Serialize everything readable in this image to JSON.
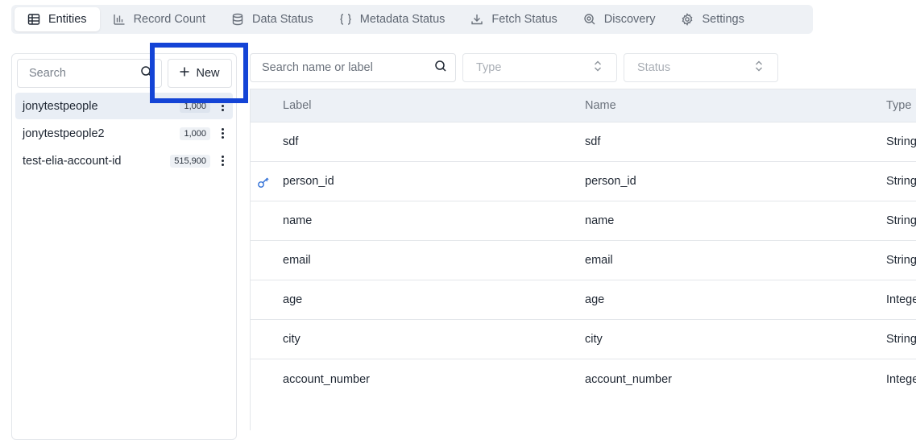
{
  "tabs": [
    {
      "label": "Entities",
      "icon": "table-icon",
      "active": true
    },
    {
      "label": "Record Count",
      "icon": "bar-chart-icon",
      "active": false
    },
    {
      "label": "Data Status",
      "icon": "database-icon",
      "active": false
    },
    {
      "label": "Metadata Status",
      "icon": "braces-icon",
      "active": false
    },
    {
      "label": "Fetch Status",
      "icon": "download-icon",
      "active": false
    },
    {
      "label": "Discovery",
      "icon": "zoom-search-icon",
      "active": false
    },
    {
      "label": "Settings",
      "icon": "gear-icon",
      "active": false
    }
  ],
  "sidebar": {
    "search_placeholder": "Search",
    "new_button_label": "New",
    "entities": [
      {
        "name": "jonytestpeople",
        "count": "1,000",
        "selected": true
      },
      {
        "name": "jonytestpeople2",
        "count": "1,000",
        "selected": false
      },
      {
        "name": "test-elia-account-id",
        "count": "515,900",
        "selected": false
      }
    ]
  },
  "main": {
    "search_placeholder": "Search name or label",
    "type_filter_placeholder": "Type",
    "status_filter_placeholder": "Status",
    "columns": {
      "label": "Label",
      "name": "Name",
      "type": "Type"
    },
    "rows": [
      {
        "label": "sdf",
        "name": "sdf",
        "type": "String",
        "key": false
      },
      {
        "label": "person_id",
        "name": "person_id",
        "type": "String",
        "key": true
      },
      {
        "label": "name",
        "name": "name",
        "type": "String",
        "key": false
      },
      {
        "label": "email",
        "name": "email",
        "type": "String",
        "key": false
      },
      {
        "label": "age",
        "name": "age",
        "type": "Integer",
        "key": false
      },
      {
        "label": "city",
        "name": "city",
        "type": "String",
        "key": false
      },
      {
        "label": "account_number",
        "name": "account_number",
        "type": "Integer",
        "key": false
      }
    ]
  },
  "colors": {
    "highlight": "#1444d6",
    "key_icon": "#2f6fd6",
    "selected_bg": "#e9eef5",
    "header_bg": "#edf1f6"
  }
}
